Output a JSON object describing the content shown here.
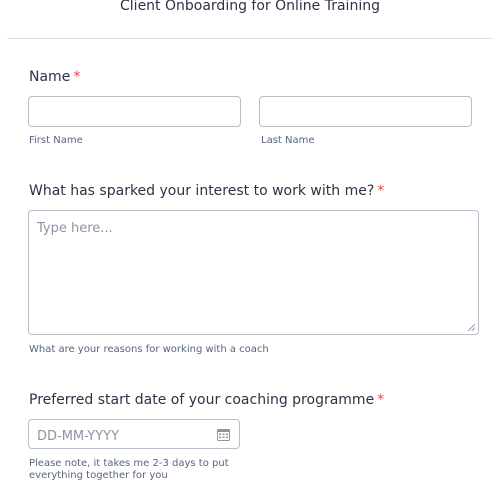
{
  "form": {
    "title": "Client Onboarding for Online Training"
  },
  "name_field": {
    "label": "Name",
    "required_mark": "*",
    "first_sublabel": "First Name",
    "last_sublabel": "Last Name",
    "first_value": "",
    "last_value": ""
  },
  "interest_field": {
    "label": "What has sparked your interest to work with me?",
    "required_mark": "*",
    "placeholder": "Type here...",
    "sublabel": "What are your reasons for working with a coach"
  },
  "date_field": {
    "label": "Preferred start date of your coaching programme",
    "required_mark": "*",
    "placeholder": "DD-MM-YYYY",
    "note_line1": "Please note, it takes me 2-3 days to put",
    "note_line2": "everything together for you",
    "icon": "calendar-icon"
  },
  "colors": {
    "required": "#e34a4a",
    "border": "#b8bdc9",
    "text": "#2c3345",
    "sublabel": "#57647e"
  }
}
